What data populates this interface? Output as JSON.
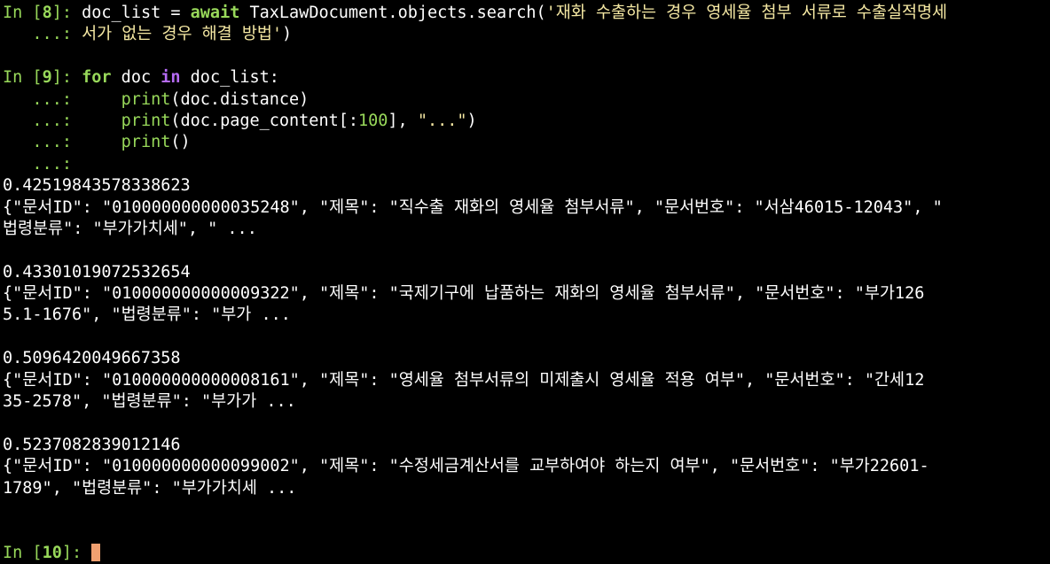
{
  "colors": {
    "background": "#000000",
    "prompt": "#98d85a",
    "keyword_purple": "#b66bf5",
    "string": "#f5e8a3",
    "text": "#ffffff",
    "cursor": "#f0a070"
  },
  "cell8": {
    "prompt_in": "In [",
    "prompt_num": "8",
    "prompt_end": "]: ",
    "code_pre": "doc_list = ",
    "code_await": "await",
    "code_mid": " TaxLawDocument.objects.search(",
    "code_str1": "'재화 수출하는 경우 영세율 첨부 서류로 수출실적명세",
    "cont_prompt": "   ...: ",
    "code_str2": "서가 없는 경우 해결 방법'",
    "code_close": ")"
  },
  "cell9": {
    "prompt_in": "In [",
    "prompt_num": "9",
    "prompt_end": "]: ",
    "for_kw": "for",
    "doc_var": " doc ",
    "in_kw": "in",
    "list_part": " doc_list:",
    "cont_prompt": "   ...: ",
    "indent": "    ",
    "print1_fn": "print",
    "print1_args": "(doc.distance)",
    "print2_fn": "print",
    "print2_args_a": "(doc.page_content[:",
    "print2_num": "100",
    "print2_args_b": "], ",
    "print2_str": "\"...\"",
    "print2_args_c": ")",
    "print3_fn": "print",
    "print3_args": "()",
    "empty_cont": "   ...:"
  },
  "results": [
    {
      "distance": "0.42519843578338623",
      "line1": "{\"문서ID\": \"010000000000035248\", \"제목\": \"직수출 재화의 영세율 첨부서류\", \"문서번호\": \"서삼46015-12043\", \"",
      "line2": "법령분류\": \"부가가치세\", \" ..."
    },
    {
      "distance": "0.43301019072532654",
      "line1": "{\"문서ID\": \"010000000000009322\", \"제목\": \"국제기구에 납품하는 재화의 영세율 첨부서류\", \"문서번호\": \"부가126",
      "line2": "5.1-1676\", \"법령분류\": \"부가 ..."
    },
    {
      "distance": "0.5096420049667358",
      "line1": "{\"문서ID\": \"010000000000008161\", \"제목\": \"영세율 첨부서류의 미제출시 영세율 적용 여부\", \"문서번호\": \"간세12",
      "line2": "35-2578\", \"법령분류\": \"부가가 ..."
    },
    {
      "distance": "0.5237082839012146",
      "line1": "{\"문서ID\": \"010000000000099002\", \"제목\": \"수정세금계산서를 교부하여야 하는지 여부\", \"문서번호\": \"부가22601-",
      "line2": "1789\", \"법령분류\": \"부가가치세 ..."
    }
  ],
  "cell10": {
    "prompt_in": "In [",
    "prompt_num": "10",
    "prompt_end": "]: "
  }
}
